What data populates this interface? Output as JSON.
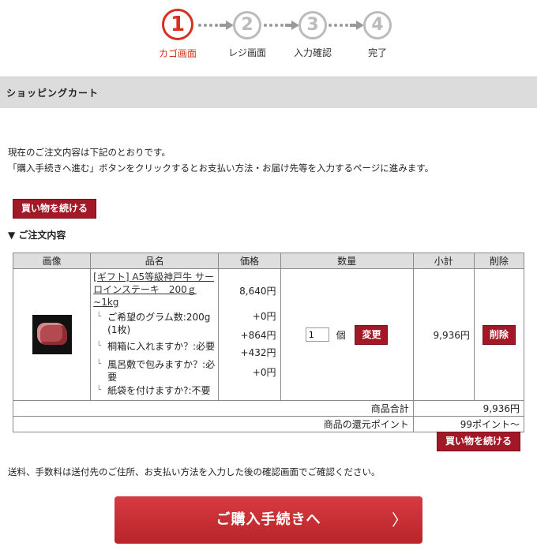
{
  "steps": [
    {
      "num": "1",
      "label": "カゴ画面",
      "active": true
    },
    {
      "num": "2",
      "label": "レジ画面",
      "active": false
    },
    {
      "num": "3",
      "label": "入力確認",
      "active": false
    },
    {
      "num": "4",
      "label": "完了",
      "active": false
    }
  ],
  "colors": {
    "accent": "#d7301f",
    "button": "#a31827",
    "header_bg": "#dcdcdc",
    "inactive": "#bbbbbb"
  },
  "header": {
    "title": "ショッピングカート"
  },
  "intro": {
    "line1": "現在のご注文内容は下記のとおりです。",
    "line2": "「購入手続きへ進む」ボタンをクリックするとお支払い方法・お届け先等を入力するページに進みます。"
  },
  "buttons": {
    "continue_shopping": "買い物を続ける",
    "change": "変更",
    "delete": "削除",
    "checkout": "ご購入手続きへ",
    "checkout_chevron": "〉"
  },
  "order_heading": "▼ ご注文内容",
  "table": {
    "headers": [
      "画像",
      "品名",
      "価格",
      "数量",
      "小計",
      "削除"
    ],
    "item": {
      "image_icon": "wagyu-steak-photo",
      "name": "[ギフト] A5等級神戸牛 サーロインステーキ　200ｇ~1kg",
      "base_price": "8,640円",
      "options": [
        {
          "label": "ご希望のグラム数:200g (1枚)",
          "price": "+0円"
        },
        {
          "label": "桐箱に入れますか？:必要",
          "price": "+864円"
        },
        {
          "label": "風呂敷で包みますか？:必要",
          "price": "+432円"
        },
        {
          "label": "紙袋を付けますか?:不要",
          "price": "+0円"
        }
      ],
      "quantity": "1",
      "unit": "個",
      "subtotal": "9,936円"
    },
    "summary": [
      {
        "label": "商品合計",
        "value": "9,936円"
      },
      {
        "label": "商品の還元ポイント",
        "value": "99ポイント〜"
      }
    ]
  },
  "shipping_note": "送料、手数料は送付先のご住所、お支払い方法を入力した後の確認画面でご確認ください。"
}
